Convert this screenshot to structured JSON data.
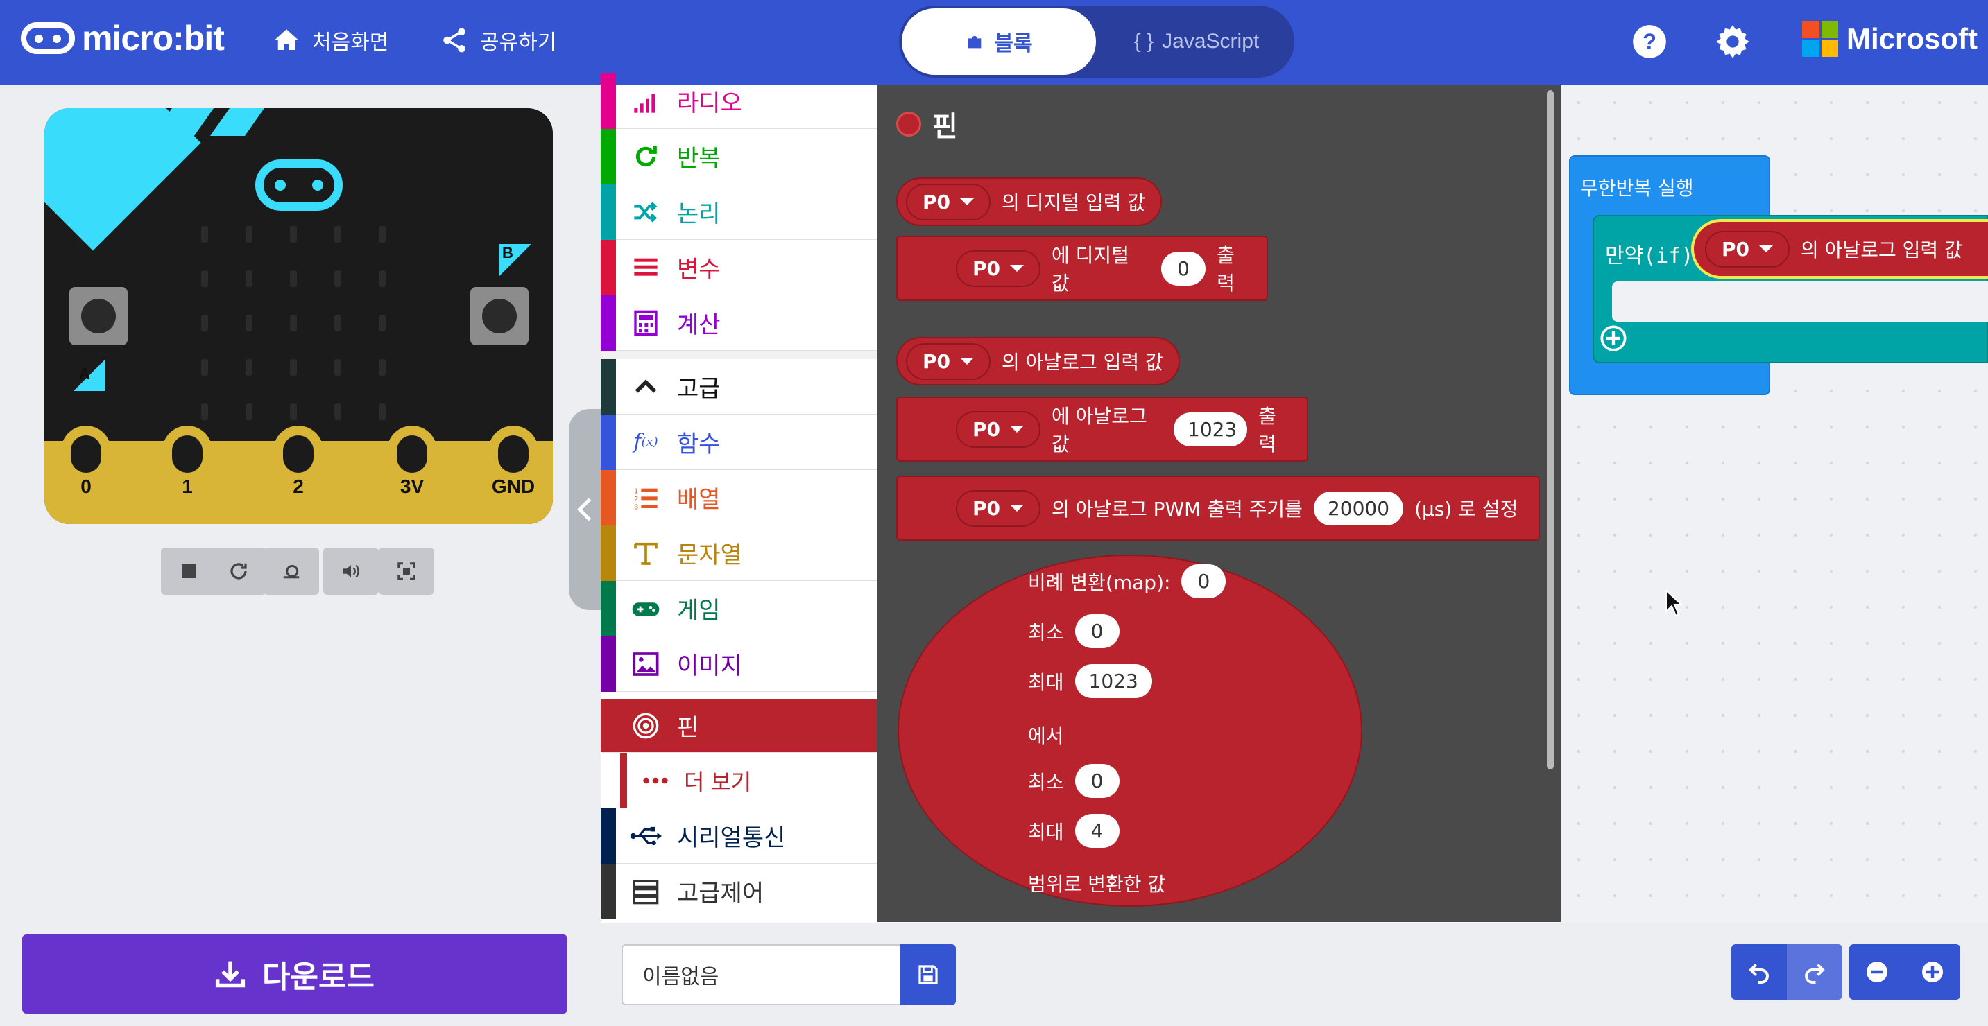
{
  "header": {
    "logo_text": "micro:bit",
    "home_label": "처음화면",
    "share_label": "공유하기",
    "tab_blocks": "블록",
    "tab_js": "JavaScript",
    "js_braces": "{ }",
    "brand": "Microsoft"
  },
  "simulator": {
    "pin_labels": [
      "0",
      "1",
      "2",
      "3V",
      "GND"
    ],
    "button_a": "A",
    "button_b": "B"
  },
  "toolbox": {
    "categories": [
      {
        "label": "라디오",
        "color": "#e3008c",
        "icon": "radio-signal-icon"
      },
      {
        "label": "반복",
        "color": "#00aa00",
        "icon": "loop-icon"
      },
      {
        "label": "논리",
        "color": "#00a4a6",
        "icon": "shuffle-logic-icon"
      },
      {
        "label": "변수",
        "color": "#dc143c",
        "icon": "variables-icon"
      },
      {
        "label": "계산",
        "color": "#9400d3",
        "icon": "calculator-icon"
      },
      {
        "label": "고급",
        "color": "#1e3a3a",
        "icon": "chevron-up-icon"
      },
      {
        "label": "함수",
        "color": "#3455db",
        "icon": "function-icon"
      },
      {
        "label": "배열",
        "color": "#e65722",
        "icon": "list-icon"
      },
      {
        "label": "문자열",
        "color": "#b8860b",
        "icon": "text-icon"
      },
      {
        "label": "게임",
        "color": "#007a4b",
        "icon": "gamepad-icon"
      },
      {
        "label": "이미지",
        "color": "#7600a8",
        "icon": "image-icon"
      },
      {
        "label": "핀",
        "color": "#b8232d",
        "icon": "pin-target-icon"
      },
      {
        "label": "더 보기",
        "color": "#b8232d",
        "icon": "more-dots-icon"
      },
      {
        "label": "시리얼통신",
        "color": "#002050",
        "icon": "usb-icon"
      },
      {
        "label": "고급제어",
        "color": "#333333",
        "icon": "server-icon"
      }
    ]
  },
  "flyout": {
    "title": "핀",
    "blocks": {
      "digital_read": {
        "pin": "P0",
        "text": "의 디지털 입력 값"
      },
      "digital_write": {
        "pin": "P0",
        "text1": "에 디지털 값",
        "value": "0",
        "text2": "출력"
      },
      "analog_read": {
        "pin": "P0",
        "text": "의 아날로그 입력 값"
      },
      "analog_write": {
        "pin": "P0",
        "text1": "에 아날로그 값",
        "value": "1023",
        "text2": "출력"
      },
      "pwm": {
        "pin": "P0",
        "text1": "의 아날로그 PWM 출력 주기를",
        "value": "20000",
        "text2": "(µs) 로 설정"
      },
      "map": {
        "label": "비례 변환(map):",
        "value": "0",
        "from_low_label": "최소",
        "from_low": "0",
        "from_high_label": "최대",
        "from_high": "1023",
        "from_label": "에서",
        "to_low_label": "최소",
        "to_low": "0",
        "to_high_label": "최대",
        "to_high": "4",
        "result_label": "범위로 변환한 값"
      }
    }
  },
  "workspace": {
    "forever_label": "무한반복 실행",
    "if_label": "만약(if)",
    "cond_pin": "P0",
    "cond_text": "의 아날로그 입력 값"
  },
  "bottom": {
    "download_label": "다운로드",
    "project_name": "이름없음"
  }
}
